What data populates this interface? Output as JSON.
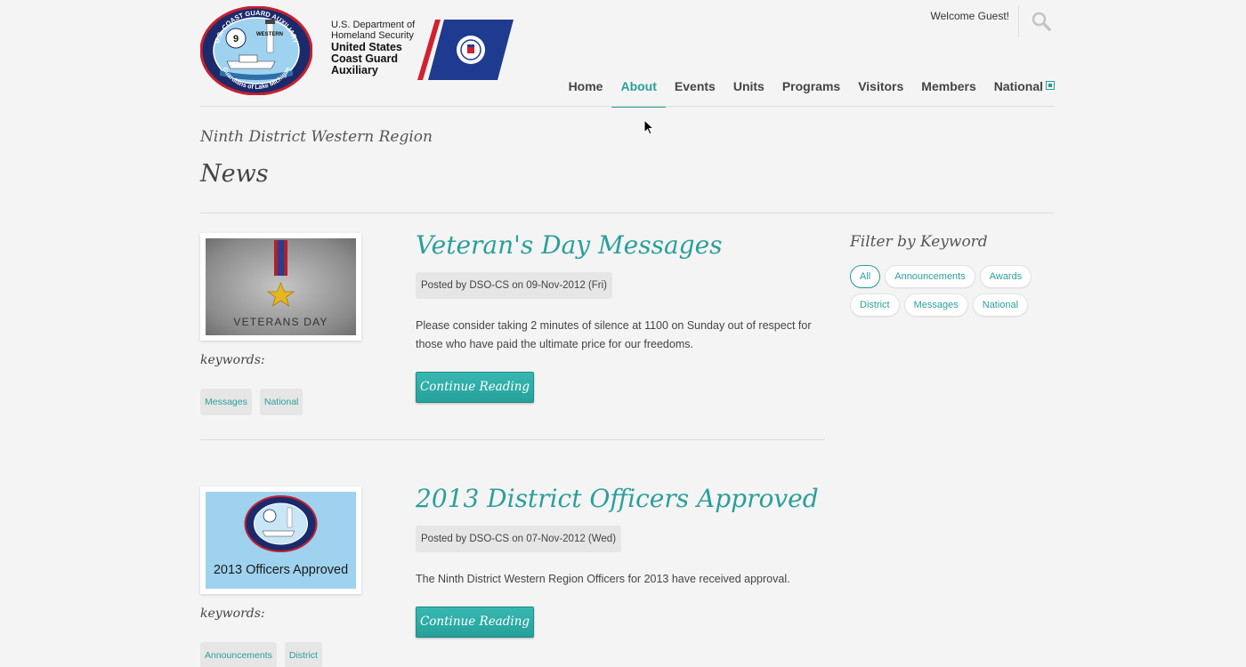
{
  "header": {
    "seal_text_top": "U.S. COAST GUARD AUXILIARY",
    "seal_text_bottom": "Guardians of Lake Michigan",
    "seal_center_number": "9",
    "seal_center_label": "WESTERN",
    "dhs_line1": "U.S. Department of",
    "dhs_line2": "Homeland Security",
    "uscg_line1": "United States",
    "uscg_line2": "Coast Guard",
    "uscg_line3": "Auxiliary",
    "welcome": "Welcome Guest!"
  },
  "nav": {
    "items": [
      {
        "label": "Home"
      },
      {
        "label": "About"
      },
      {
        "label": "Events"
      },
      {
        "label": "Units"
      },
      {
        "label": "Programs"
      },
      {
        "label": "Visitors"
      },
      {
        "label": "Members"
      },
      {
        "label": "National"
      }
    ],
    "active": "About"
  },
  "page": {
    "subtitle": "Ninth District Western Region",
    "title": "News"
  },
  "posts": [
    {
      "title": "Veteran's Day Messages",
      "meta": "Posted by DSO-CS on 09-Nov-2012 (Fri)",
      "excerpt": "Please consider taking 2 minutes of silence at 1100 on Sunday out of respect for those who have paid the ultimate price for our freedoms.",
      "button": "Continue Reading",
      "keywords_label": "keywords:",
      "keywords": [
        "Messages",
        "National"
      ],
      "thumb_caption": "VETERANS DAY"
    },
    {
      "title": "2013 District Officers Approved",
      "meta": "Posted by DSO-CS on 07-Nov-2012 (Wed)",
      "excerpt": "The Ninth District Western Region Officers for 2013 have received approval.",
      "button": "Continue Reading",
      "keywords_label": "keywords:",
      "keywords": [
        "Announcements",
        "District"
      ],
      "thumb_caption": "2013 Officers Approved"
    }
  ],
  "sidebar": {
    "title": "Filter by Keyword",
    "tags": [
      "All",
      "Announcements",
      "Awards",
      "District",
      "Messages",
      "National"
    ],
    "active": "All"
  },
  "colors": {
    "accent": "#2a9f9b",
    "background": "#f4f4f4",
    "text": "#444444"
  },
  "icons": [
    "search-icon",
    "external-link-icon",
    "star-medal-icon",
    "mouse-cursor-icon"
  ]
}
